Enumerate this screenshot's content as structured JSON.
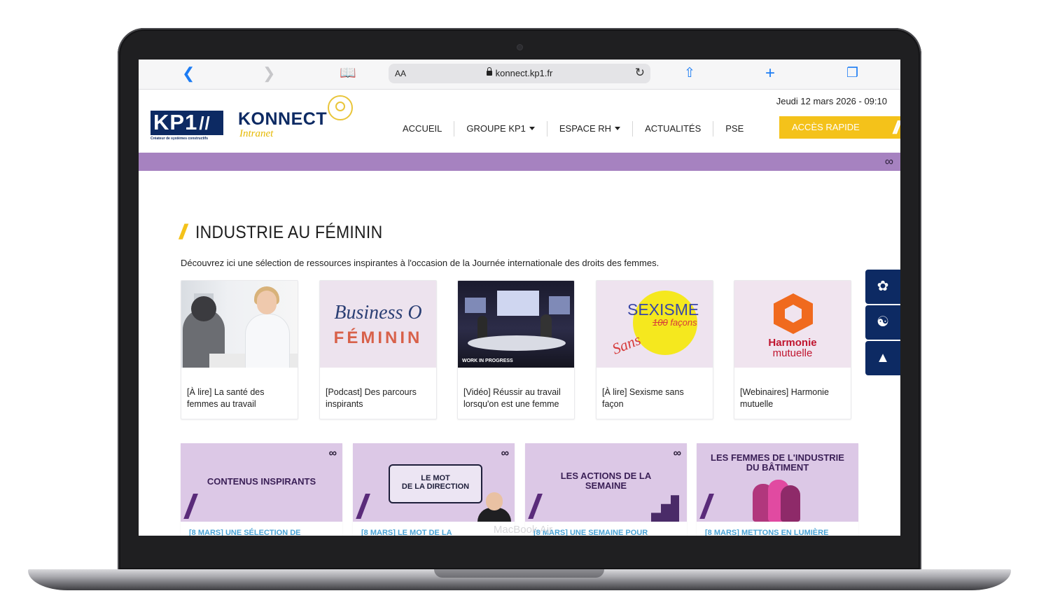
{
  "device": {
    "label": "MacBook Air"
  },
  "browser": {
    "text_size_label": "AA",
    "url": "konnect.kp1.fr",
    "icons": [
      "back-icon",
      "forward-icon",
      "bookmarks-icon",
      "lock-icon",
      "reload-icon",
      "share-icon",
      "new-tab-icon",
      "tabs-icon"
    ]
  },
  "header": {
    "logo_text": "KP1",
    "logo_slash": "//",
    "logo_tagline": "Créateur de systèmes constructifs",
    "brand_name": "KONNECT",
    "brand_sub": "Intranet",
    "date": "Jeudi 12 mars 2026 - 09:10",
    "nav": [
      {
        "label": "ACCUEIL"
      },
      {
        "label": "GROUPE KP1"
      },
      {
        "label": "ESPACE RH"
      },
      {
        "label": "ACTUALITÉS"
      },
      {
        "label": "PSE"
      }
    ],
    "quick_access": "ACCÈS RAPIDE"
  },
  "colors": {
    "navy": "#0d2a63",
    "yellow": "#f4c21a",
    "purple_banner": "#a682c0",
    "link_blue": "#4aa3d6"
  },
  "section": {
    "title": "INDUSTRIE AU FÉMININ",
    "intro": "Découvrez ici une sélection de ressources inspirantes à l'occasion de la Journée internationale des droits des femmes.",
    "cards": [
      {
        "label": "[À lire] La santé des femmes au travail"
      },
      {
        "label": "[Podcast] Des parcours inspirants",
        "image_top": "Business O",
        "image_bottom": "FÉMININ"
      },
      {
        "label": "[Vidéo] Réussir au travail lorsqu'on est une femme",
        "image_caption": "WORK IN PROGRESS"
      },
      {
        "label": "[À lire] Sexisme sans façon",
        "image_title": "SEXISME",
        "image_struck": "100",
        "image_word": "façons",
        "image_script": "Sans"
      },
      {
        "label": "[Webinaires] Harmonie mutuelle",
        "image_name": "Harmonie",
        "image_sub": "mutuelle"
      }
    ]
  },
  "news": [
    {
      "image_title": "CONTENUS INSPIRANTS",
      "link": "[8 MARS] UNE SÉLECTION DE"
    },
    {
      "image_title_1": "LE MOT",
      "image_title_2": "DE LA DIRECTION",
      "link": "[8 MARS] LE MOT DE LA"
    },
    {
      "image_title": "LES ACTIONS DE LA SEMAINE",
      "link": "[8 MARS] UNE SEMAINE POUR"
    },
    {
      "image_title": "LES FEMMES DE L'INDUSTRIE DU BÂTIMENT",
      "link": "[8 MARS] METTONS EN LUMIÈRE"
    }
  ],
  "side_tabs": [
    "lotus-icon",
    "handshake-icon",
    "graduation-cap-icon"
  ]
}
